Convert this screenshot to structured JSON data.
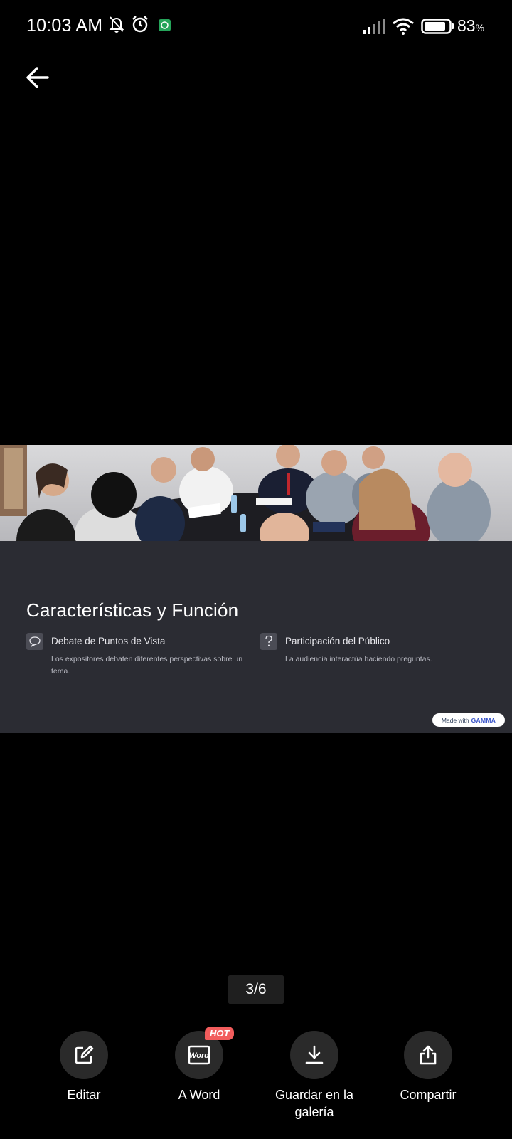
{
  "status_bar": {
    "time": "10:03 AM",
    "battery_percent": "83",
    "battery_unit": "%",
    "icons": [
      "bell-off-icon",
      "alarm-icon",
      "whatsapp-icon",
      "signal-icon",
      "wifi-icon",
      "battery-icon"
    ]
  },
  "toolbar": {
    "back_icon": "arrow-left-icon"
  },
  "slide": {
    "title": "Características y Función",
    "features": [
      {
        "icon": "speech-bubble-icon",
        "title": "Debate de Puntos de Vista",
        "description": "Los expositores debaten diferentes perspectivas sobre un tema."
      },
      {
        "icon": "question-icon",
        "title": "Participación del Público",
        "description": "La audiencia interactúa haciendo preguntas."
      }
    ],
    "badge": {
      "prefix": "Made with",
      "brand": "GAMMA"
    }
  },
  "pager": {
    "label": "3/6",
    "current": 3,
    "total": 6
  },
  "actions": [
    {
      "icon": "edit-icon",
      "label": "Editar"
    },
    {
      "icon": "word-icon",
      "label": "A Word",
      "badge": "HOT"
    },
    {
      "icon": "download-icon",
      "label": "Guardar en la galería"
    },
    {
      "icon": "share-icon",
      "label": "Compartir"
    }
  ],
  "colors": {
    "background": "#000000",
    "slide_bg": "#2b2c33",
    "hot_badge": "#f25c5c",
    "gamma_brand": "#3a55c9"
  }
}
